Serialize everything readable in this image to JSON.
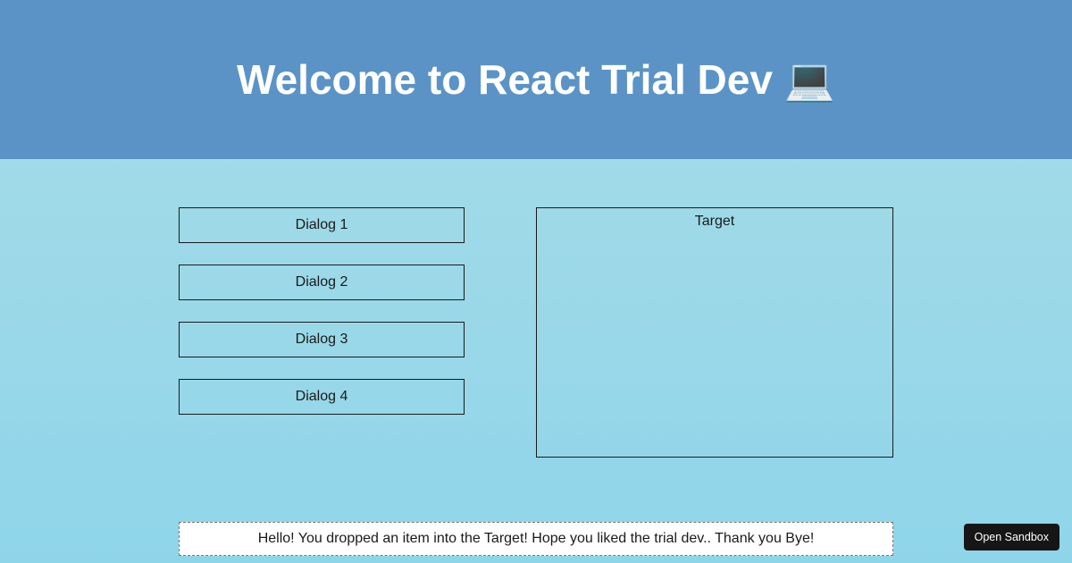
{
  "header": {
    "title": "Welcome to React Trial Dev 💻"
  },
  "dialogs": {
    "items": [
      {
        "label": "Dialog 1"
      },
      {
        "label": "Dialog 2"
      },
      {
        "label": "Dialog 3"
      },
      {
        "label": "Dialog 4"
      }
    ]
  },
  "target": {
    "label": "Target"
  },
  "message": {
    "text": "Hello! You dropped an item into the Target! Hope you liked the trial dev.. Thank you Bye!"
  },
  "sandbox": {
    "button_label": "Open Sandbox"
  }
}
